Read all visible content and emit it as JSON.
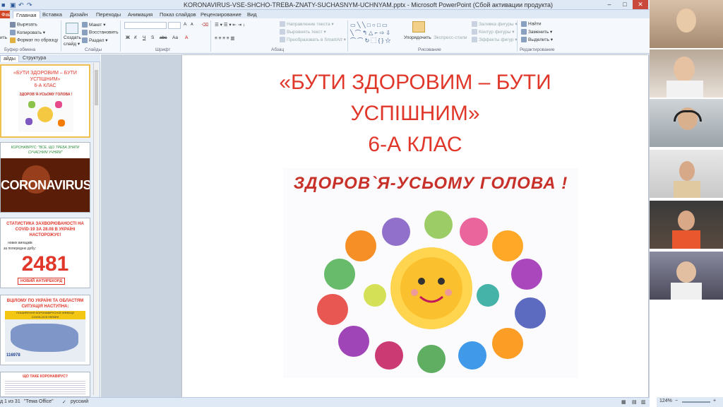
{
  "window": {
    "title": "KORONAVIRUS-VSE-SHCHO-TREBA-ZNATY-SUCHASNYM-UCHNYAM.pptx - Microsoft PowerPoint (Сбой активации продукта)"
  },
  "tabs": [
    {
      "label": "Файл"
    },
    {
      "label": "Главная"
    },
    {
      "label": "Вставка"
    },
    {
      "label": "Дизайн"
    },
    {
      "label": "Переходы"
    },
    {
      "label": "Анимация"
    },
    {
      "label": "Показ слайдов"
    },
    {
      "label": "Рецензирование"
    },
    {
      "label": "Вид"
    }
  ],
  "ribbon": {
    "clipboard": {
      "paste": "ить",
      "cut": "Вырезать",
      "copy": "Копировать",
      "format": "Формат по образцу",
      "group": "Буфер обмена"
    },
    "slides": {
      "create": "Создать",
      "create2": "слайд",
      "layout": "Макет",
      "reset": "Восстановить",
      "section": "Раздел",
      "group": "Слайды"
    },
    "font": {
      "bold": "Ж",
      "italic": "К",
      "underline": "Ч",
      "strike": "S",
      "spacing": "abc",
      "size_up": "A",
      "size_down": "A",
      "case": "Aa",
      "color": "A",
      "group": "Шрифт"
    },
    "paragraph": {
      "direction": "Направление текста",
      "align": "Выровнять текст",
      "smartart": "Преобразовать в SmartArt",
      "group": "Абзац"
    },
    "drawing": {
      "arrange": "Упорядочить",
      "styles": "Экспресс-стили",
      "fill": "Заливка фигуры",
      "outline": "Контур фигуры",
      "effects": "Эффекты фигур",
      "group": "Рисование"
    },
    "editing": {
      "find": "Найти",
      "replace": "Заменить",
      "select": "Выделить",
      "group": "Редактирование"
    }
  },
  "panel": {
    "tab_slides": "айды",
    "tab_outline": "Структура",
    "slides": [
      {
        "number": "1",
        "line1": "«БУТИ ЗДОРОВИМ – БУТИ",
        "line2": "УСПІШНИМ»",
        "line3": "6-А КЛАС",
        "poster": "ЗДОРОВ`Я-УСЬОМУ ГОЛОВА !"
      },
      {
        "number": "2",
        "header": "КОРОНАВІРУС: \"ВСЕ, ЩО ТРЕБА ЗНАТИ СУЧАСНИМ УЧНЯМ\"",
        "banner": "CORONAVIRUS"
      },
      {
        "number": "3",
        "title": "СТАТИСТИКА ЗАХВОРЮВАНОСТІ НА COVID-19 ЗА 28.08 В УКРАЇНІ НАСТОРОЖУЄ!",
        "subtitle1": "нових випадків",
        "subtitle2": "за попередню добу:",
        "big_number": "2481",
        "badge": "НОВИЙ АНТИРЕКОРД"
      },
      {
        "number": "4",
        "title": "ВЦІЛОМУ ПО УКРАЇНІ ТА ОБЛАСТЯМ СИТУАЦІЯ НАСТУПНА:",
        "banner1": "ПОШИРЕННЯ КОРОНАВІРУСНОЇ ІНФЕКЦІЇ",
        "banner2": "COVID-19 В УКРАЇНІ",
        "count": "116978"
      },
      {
        "number": "5",
        "title": "ЩО ТАКЕ КОРОНАВІРУС?"
      }
    ]
  },
  "slide": {
    "title_line1": "«БУТИ ЗДОРОВИМ – БУТИ",
    "title_line2": "УСПІШНИМ»",
    "title_line3": "6-А КЛАС",
    "poster_caption": "ЗДОРОВ`Я-УСЬОМУ ГОЛОВА !"
  },
  "status": {
    "slide_counter": "д 1 из 31",
    "theme": "\"Тема Office\"",
    "language": "русский",
    "zoom": "124%"
  },
  "colors": {
    "accent": "#d24726",
    "title_red": "#e0372a",
    "ribbon_bg": "#f5f8fc"
  }
}
